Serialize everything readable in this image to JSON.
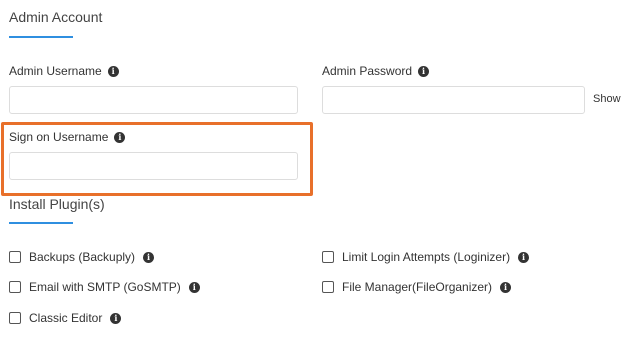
{
  "admin_account": {
    "title": "Admin Account",
    "username_label": "Admin Username",
    "username_value": "",
    "password_label": "Admin Password",
    "password_value": "",
    "show_label": "Show",
    "sign_on_label": "Sign on Username",
    "sign_on_value": ""
  },
  "plugins": {
    "title": "Install Plugin(s)",
    "items": [
      {
        "label": "Backups (Backuply)",
        "checked": false
      },
      {
        "label": "Limit Login Attempts (Loginizer)",
        "checked": false
      },
      {
        "label": "Email with SMTP (GoSMTP)",
        "checked": false
      },
      {
        "label": "File Manager(FileOrganizer)",
        "checked": false
      },
      {
        "label": "Classic Editor",
        "checked": false
      }
    ]
  },
  "icons": {
    "info": "info-icon",
    "info_glyph": "i"
  },
  "colors": {
    "accent": "#2f8fe0",
    "highlight": "#e8702a"
  }
}
